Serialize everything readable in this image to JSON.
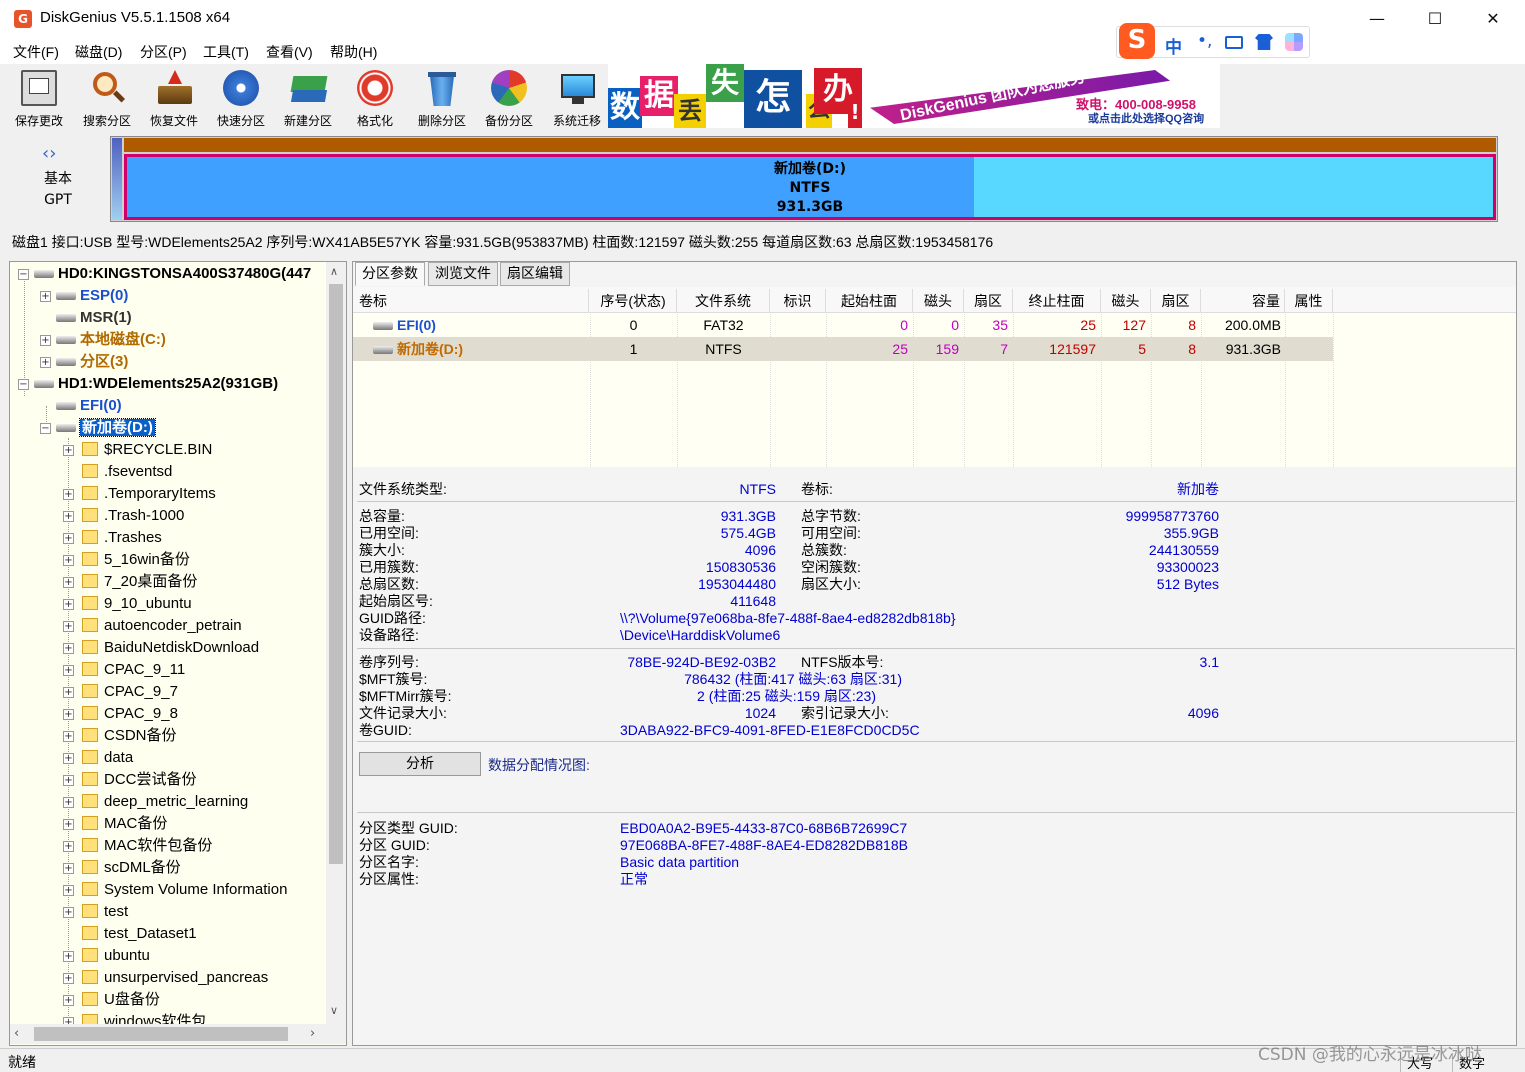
{
  "window": {
    "title": "DiskGenius V5.5.1.1508 x64",
    "app_icon": "G"
  },
  "menu": [
    "文件(F)",
    "磁盘(D)",
    "分区(P)",
    "工具(T)",
    "查看(V)",
    "帮助(H)"
  ],
  "ime": {
    "label": "中"
  },
  "toolbar": [
    "保存更改",
    "搜索分区",
    "恢复文件",
    "快速分区",
    "新建分区",
    "格式化",
    "删除分区",
    "备份分区",
    "系统迁移"
  ],
  "banner": {
    "chars": [
      "数",
      "据",
      "丢",
      "失",
      "怎",
      "么",
      "办",
      "!"
    ],
    "slogan": "DiskGenius 团队为您服务",
    "phone": "致电：400-008-9958",
    "qq": "或点击此处选择QQ咨询"
  },
  "diskmap": {
    "type_line1": "基本",
    "type_line2": "GPT",
    "partition_name": "新加卷(D:)",
    "partition_fs": "NTFS",
    "partition_size": "931.3GB"
  },
  "disk_info": "磁盘1 接口:USB  型号:WDElements25A2  序列号:WX41AB5E57YK  容量:931.5GB(953837MB)  柱面数:121597  磁头数:255  每道扇区数:63  总扇区数:1953458176",
  "tree": {
    "hd0": "HD0:KINGSTONSA400S37480G(447",
    "hd0_children": [
      "ESP(0)",
      "MSR(1)",
      "本地磁盘(C:)",
      "分区(3)"
    ],
    "hd1": "HD1:WDElements25A2(931GB)",
    "hd1_children": [
      "EFI(0)",
      "新加卷(D:)"
    ],
    "folders": [
      "$RECYCLE.BIN",
      ".fseventsd",
      ".TemporaryItems",
      ".Trash-1000",
      ".Trashes",
      "5_16win备份",
      "7_20桌面备份",
      "9_10_ubuntu",
      "autoencoder_petrain",
      "BaiduNetdiskDownload",
      "CPAC_9_11",
      "CPAC_9_7",
      "CPAC_9_8",
      "CSDN备份",
      "data",
      "DCC尝试备份",
      "deep_metric_learning",
      "MAC备份",
      "MAC软件包备份",
      "scDML备份",
      "System Volume Information",
      "test",
      "test_Dataset1",
      "ubuntu",
      "unsurpervised_pancreas",
      "U盘备份",
      "windows软件包"
    ]
  },
  "tabs": [
    "分区参数",
    "浏览文件",
    "扇区编辑"
  ],
  "table": {
    "headers": [
      "卷标",
      "序号(状态)",
      "文件系统",
      "标识",
      "起始柱面",
      "磁头",
      "扇区",
      "终止柱面",
      "磁头",
      "扇区",
      "容量",
      "属性"
    ],
    "rows": [
      [
        "EFI(0)",
        "0",
        "FAT32",
        "",
        "0",
        "0",
        "35",
        "25",
        "127",
        "8",
        "200.0MB",
        ""
      ],
      [
        "新加卷(D:)",
        "1",
        "NTFS",
        "",
        "25",
        "159",
        "7",
        "121597",
        "5",
        "8",
        "931.3GB",
        ""
      ]
    ]
  },
  "details": {
    "fs_type_label": "文件系统类型:",
    "fs_type": "NTFS",
    "vol_label_label": "卷标:",
    "vol_label": "新加卷",
    "left": [
      [
        "总容量:",
        "931.3GB"
      ],
      [
        "已用空间:",
        "575.4GB"
      ],
      [
        "簇大小:",
        "4096"
      ],
      [
        "已用簇数:",
        "150830536"
      ],
      [
        "总扇区数:",
        "1953044480"
      ],
      [
        "起始扇区号:",
        "411648"
      ]
    ],
    "right": [
      [
        "总字节数:",
        "999958773760"
      ],
      [
        "可用空间:",
        "355.9GB"
      ],
      [
        "总簇数:",
        "244130559"
      ],
      [
        "空闲簇数:",
        "93300023"
      ],
      [
        "扇区大小:",
        "512 Bytes"
      ]
    ],
    "guid_path_label": "GUID路径:",
    "guid_path": "\\\\?\\Volume{97e068ba-8fe7-488f-8ae4-ed8282db818b}",
    "device_path_label": "设备路径:",
    "device_path": "\\Device\\HarddiskVolume6",
    "serial_label": "卷序列号:",
    "serial": "78BE-924D-BE92-03B2",
    "ntfs_ver_label": "NTFS版本号:",
    "ntfs_ver": "3.1",
    "mft_label": "$MFT簇号:",
    "mft": "786432 (柱面:417 磁头:63 扇区:31)",
    "mftmirr_label": "$MFTMirr簇号:",
    "mftmirr": "2 (柱面:25 磁头:159 扇区:23)",
    "rec_size_label": "文件记录大小:",
    "rec_size": "1024",
    "idx_size_label": "索引记录大小:",
    "idx_size": "4096",
    "vol_guid_label": "卷GUID:",
    "vol_guid": "3DABA922-BFC9-4091-8FED-E1E8FCD0CD5C",
    "analyze_button": "分析",
    "alloc_label": "数据分配情况图:",
    "ptype_guid_label": "分区类型 GUID:",
    "ptype_guid": "EBD0A0A2-B9E5-4433-87C0-68B6B72699C7",
    "part_guid_label": "分区 GUID:",
    "part_guid": "97E068BA-8FE7-488F-8AE4-ED8282DB818B",
    "part_name_label": "分区名字:",
    "part_name": "Basic data partition",
    "part_attr_label": "分区属性:",
    "part_attr": "正常"
  },
  "status": {
    "left": "就绪",
    "caps": "大写",
    "num": "数字",
    "watermark": "CSDN @我的心永远是冰冰哒"
  }
}
